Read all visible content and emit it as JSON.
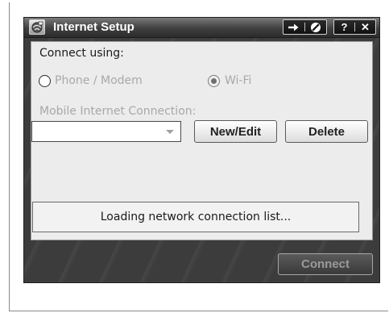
{
  "window": {
    "title": "Internet Setup",
    "app_icon": "internet-setup-icon"
  },
  "titlebar_buttons": {
    "group1": [
      {
        "icon": "arrow-right-icon",
        "glyph": "➔"
      },
      {
        "icon": "no-entry-icon",
        "glyph": "⊘"
      }
    ],
    "group2": [
      {
        "icon": "help-icon",
        "glyph": "?"
      },
      {
        "icon": "close-icon",
        "glyph": "✕"
      }
    ]
  },
  "form": {
    "connect_using_label": "Connect using:",
    "radio_phone_label": "Phone / Modem",
    "radio_wifi_label": "Wi-Fi",
    "selected_option": "Wi-Fi",
    "mobile_connection_label": "Mobile Internet Connection:",
    "mobile_connection_value": "",
    "new_edit_button": "New/Edit",
    "delete_button": "Delete",
    "status_text": "Loading network connection list..."
  },
  "footer": {
    "connect_button": "Connect"
  },
  "colors": {
    "chrome_dark": "#3c3c3c",
    "panel_bg": "#ececec",
    "disabled_text": "#a8a8a8",
    "enabled_text": "#1a1a1a"
  }
}
